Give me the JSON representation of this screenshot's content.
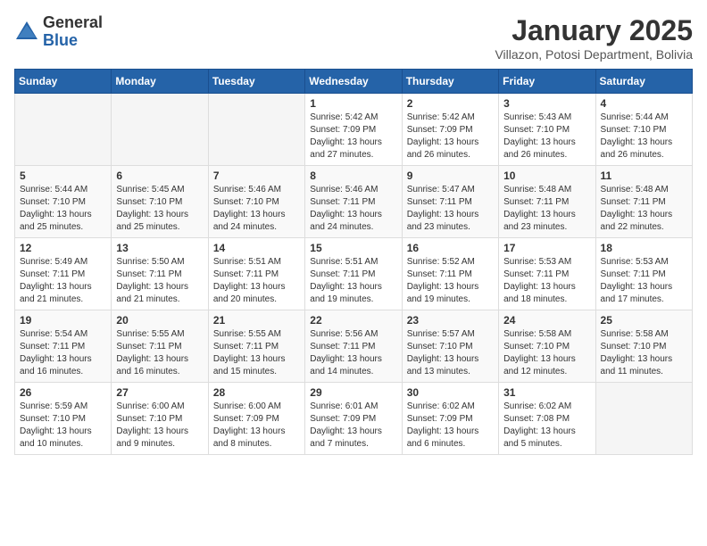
{
  "header": {
    "logo_general": "General",
    "logo_blue": "Blue",
    "month_title": "January 2025",
    "subtitle": "Villazon, Potosi Department, Bolivia"
  },
  "weekdays": [
    "Sunday",
    "Monday",
    "Tuesday",
    "Wednesday",
    "Thursday",
    "Friday",
    "Saturday"
  ],
  "weeks": [
    [
      {
        "day": "",
        "info": ""
      },
      {
        "day": "",
        "info": ""
      },
      {
        "day": "",
        "info": ""
      },
      {
        "day": "1",
        "info": "Sunrise: 5:42 AM\nSunset: 7:09 PM\nDaylight: 13 hours\nand 27 minutes."
      },
      {
        "day": "2",
        "info": "Sunrise: 5:42 AM\nSunset: 7:09 PM\nDaylight: 13 hours\nand 26 minutes."
      },
      {
        "day": "3",
        "info": "Sunrise: 5:43 AM\nSunset: 7:10 PM\nDaylight: 13 hours\nand 26 minutes."
      },
      {
        "day": "4",
        "info": "Sunrise: 5:44 AM\nSunset: 7:10 PM\nDaylight: 13 hours\nand 26 minutes."
      }
    ],
    [
      {
        "day": "5",
        "info": "Sunrise: 5:44 AM\nSunset: 7:10 PM\nDaylight: 13 hours\nand 25 minutes."
      },
      {
        "day": "6",
        "info": "Sunrise: 5:45 AM\nSunset: 7:10 PM\nDaylight: 13 hours\nand 25 minutes."
      },
      {
        "day": "7",
        "info": "Sunrise: 5:46 AM\nSunset: 7:10 PM\nDaylight: 13 hours\nand 24 minutes."
      },
      {
        "day": "8",
        "info": "Sunrise: 5:46 AM\nSunset: 7:11 PM\nDaylight: 13 hours\nand 24 minutes."
      },
      {
        "day": "9",
        "info": "Sunrise: 5:47 AM\nSunset: 7:11 PM\nDaylight: 13 hours\nand 23 minutes."
      },
      {
        "day": "10",
        "info": "Sunrise: 5:48 AM\nSunset: 7:11 PM\nDaylight: 13 hours\nand 23 minutes."
      },
      {
        "day": "11",
        "info": "Sunrise: 5:48 AM\nSunset: 7:11 PM\nDaylight: 13 hours\nand 22 minutes."
      }
    ],
    [
      {
        "day": "12",
        "info": "Sunrise: 5:49 AM\nSunset: 7:11 PM\nDaylight: 13 hours\nand 21 minutes."
      },
      {
        "day": "13",
        "info": "Sunrise: 5:50 AM\nSunset: 7:11 PM\nDaylight: 13 hours\nand 21 minutes."
      },
      {
        "day": "14",
        "info": "Sunrise: 5:51 AM\nSunset: 7:11 PM\nDaylight: 13 hours\nand 20 minutes."
      },
      {
        "day": "15",
        "info": "Sunrise: 5:51 AM\nSunset: 7:11 PM\nDaylight: 13 hours\nand 19 minutes."
      },
      {
        "day": "16",
        "info": "Sunrise: 5:52 AM\nSunset: 7:11 PM\nDaylight: 13 hours\nand 19 minutes."
      },
      {
        "day": "17",
        "info": "Sunrise: 5:53 AM\nSunset: 7:11 PM\nDaylight: 13 hours\nand 18 minutes."
      },
      {
        "day": "18",
        "info": "Sunrise: 5:53 AM\nSunset: 7:11 PM\nDaylight: 13 hours\nand 17 minutes."
      }
    ],
    [
      {
        "day": "19",
        "info": "Sunrise: 5:54 AM\nSunset: 7:11 PM\nDaylight: 13 hours\nand 16 minutes."
      },
      {
        "day": "20",
        "info": "Sunrise: 5:55 AM\nSunset: 7:11 PM\nDaylight: 13 hours\nand 16 minutes."
      },
      {
        "day": "21",
        "info": "Sunrise: 5:55 AM\nSunset: 7:11 PM\nDaylight: 13 hours\nand 15 minutes."
      },
      {
        "day": "22",
        "info": "Sunrise: 5:56 AM\nSunset: 7:11 PM\nDaylight: 13 hours\nand 14 minutes."
      },
      {
        "day": "23",
        "info": "Sunrise: 5:57 AM\nSunset: 7:10 PM\nDaylight: 13 hours\nand 13 minutes."
      },
      {
        "day": "24",
        "info": "Sunrise: 5:58 AM\nSunset: 7:10 PM\nDaylight: 13 hours\nand 12 minutes."
      },
      {
        "day": "25",
        "info": "Sunrise: 5:58 AM\nSunset: 7:10 PM\nDaylight: 13 hours\nand 11 minutes."
      }
    ],
    [
      {
        "day": "26",
        "info": "Sunrise: 5:59 AM\nSunset: 7:10 PM\nDaylight: 13 hours\nand 10 minutes."
      },
      {
        "day": "27",
        "info": "Sunrise: 6:00 AM\nSunset: 7:10 PM\nDaylight: 13 hours\nand 9 minutes."
      },
      {
        "day": "28",
        "info": "Sunrise: 6:00 AM\nSunset: 7:09 PM\nDaylight: 13 hours\nand 8 minutes."
      },
      {
        "day": "29",
        "info": "Sunrise: 6:01 AM\nSunset: 7:09 PM\nDaylight: 13 hours\nand 7 minutes."
      },
      {
        "day": "30",
        "info": "Sunrise: 6:02 AM\nSunset: 7:09 PM\nDaylight: 13 hours\nand 6 minutes."
      },
      {
        "day": "31",
        "info": "Sunrise: 6:02 AM\nSunset: 7:08 PM\nDaylight: 13 hours\nand 5 minutes."
      },
      {
        "day": "",
        "info": ""
      }
    ]
  ]
}
